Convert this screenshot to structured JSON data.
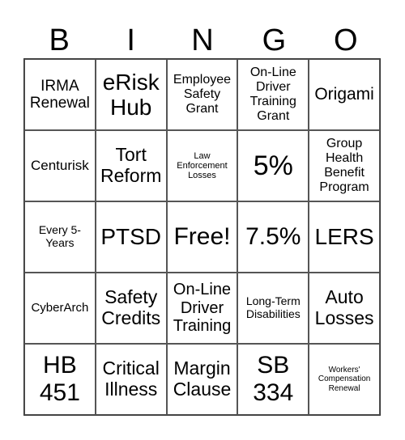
{
  "header": [
    "B",
    "I",
    "N",
    "G",
    "O"
  ],
  "cells": [
    {
      "text": "IRMA Renewal",
      "size": 19
    },
    {
      "text": "eRisk Hub",
      "size": 28
    },
    {
      "text": "Employee Safety Grant",
      "size": 16
    },
    {
      "text": "On-Line Driver Training Grant",
      "size": 16
    },
    {
      "text": "Origami",
      "size": 21
    },
    {
      "text": "Centurisk",
      "size": 17
    },
    {
      "text": "Tort Reform",
      "size": 23
    },
    {
      "text": "Law Enforcement Losses",
      "size": 11
    },
    {
      "text": "5%",
      "size": 34
    },
    {
      "text": "Group Health Benefit Program",
      "size": 16
    },
    {
      "text": "Every 5- Years",
      "size": 14
    },
    {
      "text": "PTSD",
      "size": 28
    },
    {
      "text": "Free!",
      "size": 30
    },
    {
      "text": "7.5%",
      "size": 30
    },
    {
      "text": "LERS",
      "size": 28
    },
    {
      "text": "CyberArch",
      "size": 15
    },
    {
      "text": "Safety Credits",
      "size": 23
    },
    {
      "text": "On-Line Driver Training",
      "size": 20
    },
    {
      "text": "Long-Term Disabilities",
      "size": 14
    },
    {
      "text": "Auto Losses",
      "size": 23
    },
    {
      "text": "HB 451",
      "size": 30
    },
    {
      "text": "Critical Illness",
      "size": 23
    },
    {
      "text": "Margin Clause",
      "size": 23
    },
    {
      "text": "SB 334",
      "size": 30
    },
    {
      "text": "Workers' Compensation Renewal",
      "size": 10
    }
  ]
}
